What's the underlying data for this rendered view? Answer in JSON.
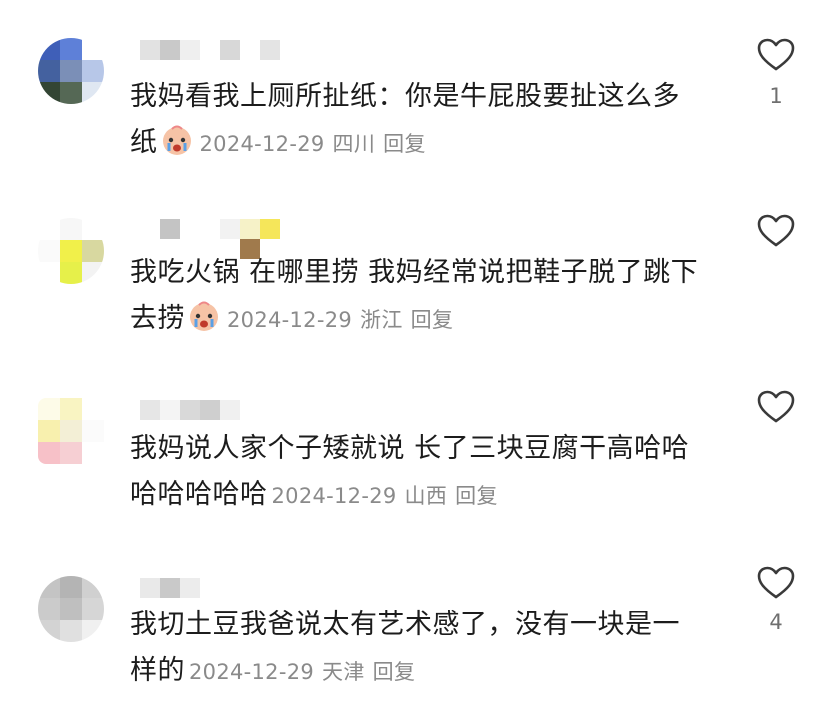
{
  "comments": [
    {
      "text_line1": "我妈看我上厕所扯纸：你是牛屁股要扯这么多",
      "text_line2": "纸",
      "emoji": "crying-face-emoji",
      "date": "2024-12-29",
      "location": "四川",
      "reply_label": "回复",
      "like_count": "1"
    },
    {
      "text_line1": "我吃火锅 在哪里捞 我妈经常说把鞋子脱了跳下",
      "text_line2": "去捞",
      "emoji": "crying-face-emoji",
      "date": "2024-12-29",
      "location": "浙江",
      "reply_label": "回复",
      "like_count": ""
    },
    {
      "text_line1": "我妈说人家个子矮就说 长了三块豆腐干高哈哈",
      "text_line2": "哈哈哈哈哈",
      "emoji": "",
      "date": "2024-12-29",
      "location": "山西",
      "reply_label": "回复",
      "like_count": ""
    },
    {
      "text_line1": "我切土豆我爸说太有艺术感了，没有一块是一",
      "text_line2": "样的",
      "emoji": "",
      "date": "2024-12-29",
      "location": "天津",
      "reply_label": "回复",
      "like_count": "4"
    }
  ],
  "colors": {
    "text": "#1c1c1c",
    "meta": "#8a8a8a",
    "like_outline": "#3a3a3a"
  }
}
